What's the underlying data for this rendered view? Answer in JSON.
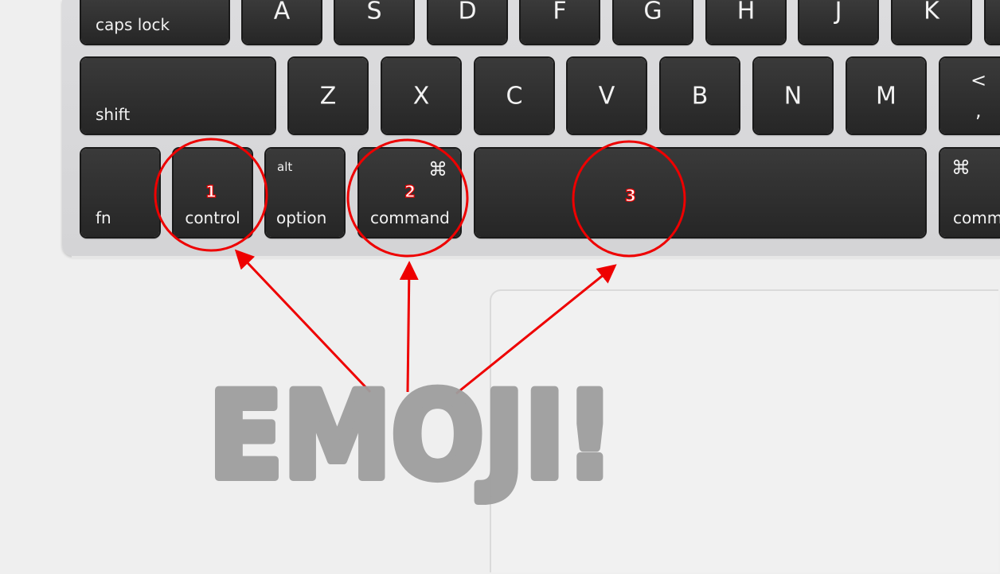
{
  "keyboard": {
    "row1": [
      {
        "label": "caps lock"
      },
      {
        "label": "A"
      },
      {
        "label": "S"
      },
      {
        "label": "D"
      },
      {
        "label": "F"
      },
      {
        "label": "G"
      },
      {
        "label": "H"
      },
      {
        "label": "J"
      },
      {
        "label": "K"
      }
    ],
    "row2": [
      {
        "label": "shift"
      },
      {
        "label": "Z"
      },
      {
        "label": "X"
      },
      {
        "label": "C"
      },
      {
        "label": "V"
      },
      {
        "label": "B"
      },
      {
        "label": "N"
      },
      {
        "label": "M"
      },
      {
        "label": "<",
        "sub": ","
      }
    ],
    "row3": [
      {
        "label": "fn"
      },
      {
        "label": "control"
      },
      {
        "label": "option",
        "alt": "alt"
      },
      {
        "label": "command",
        "symbol": "⌘"
      },
      {
        "label": ""
      },
      {
        "label": "comm",
        "symbol": "⌘"
      }
    ]
  },
  "annotations": {
    "markers": [
      "1",
      "2",
      "3"
    ],
    "color": "#ee0000",
    "handwritten_text": "EMOJI!",
    "handwritten_color": "#9e9e9e"
  }
}
